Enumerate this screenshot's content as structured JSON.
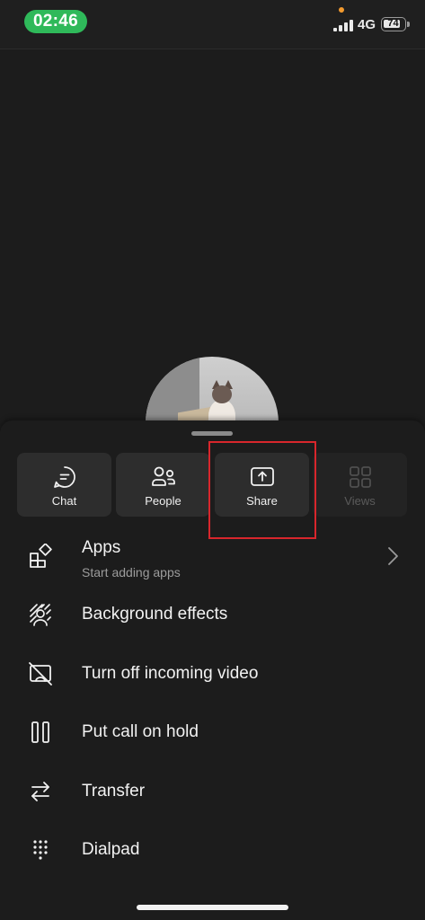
{
  "status_bar": {
    "time": "02:46",
    "network": "4G",
    "battery": "74"
  },
  "tiles": [
    {
      "label": "Chat",
      "icon": "chat-icon",
      "enabled": true
    },
    {
      "label": "People",
      "icon": "people-icon",
      "enabled": true
    },
    {
      "label": "Share",
      "icon": "share-screen-icon",
      "enabled": true
    },
    {
      "label": "Views",
      "icon": "views-grid-icon",
      "enabled": false
    }
  ],
  "menu": {
    "apps": {
      "title": "Apps",
      "subtitle": "Start adding apps",
      "icon": "apps-icon"
    },
    "background_effects": {
      "title": "Background effects",
      "icon": "background-effects-icon"
    },
    "incoming_video": {
      "title": "Turn off incoming video",
      "icon": "video-off-icon"
    },
    "hold": {
      "title": "Put call on hold",
      "icon": "pause-icon"
    },
    "transfer": {
      "title": "Transfer",
      "icon": "transfer-icon"
    },
    "dialpad": {
      "title": "Dialpad",
      "icon": "dialpad-icon"
    }
  },
  "colors": {
    "time_pill": "#2fb95a",
    "highlight": "#d8262c",
    "background": "#1c1c1c",
    "tile": "#2d2d2d"
  }
}
